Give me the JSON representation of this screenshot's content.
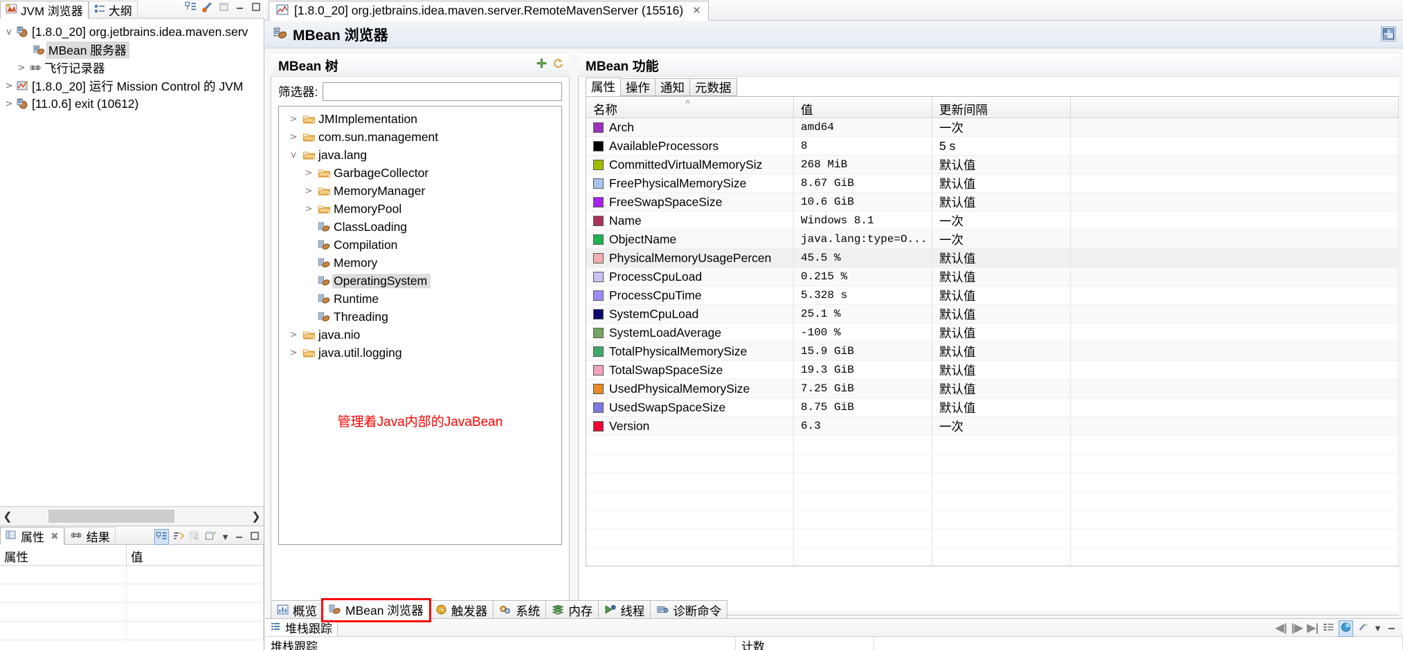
{
  "left_panel": {
    "tabs": [
      {
        "label": "JVM 浏览器",
        "icon": "jvm-browser-icon",
        "active": true
      },
      {
        "label": "大纲",
        "icon": "outline-icon",
        "active": false
      }
    ],
    "toolbar_icons": [
      "collapse-all-icon",
      "connect-icon"
    ],
    "window_buttons": [
      "new-window-icon",
      "minimize-icon",
      "maximize-icon"
    ],
    "tree": [
      {
        "label": "[1.8.0_20] org.jetbrains.idea.maven.serv",
        "indent": 0,
        "twisty": "v",
        "icon": "jvm-connection-icon",
        "selected": false
      },
      {
        "label": "MBean 服务器",
        "indent": 1,
        "twisty": "",
        "icon": "mbean-server-icon",
        "selected": true
      },
      {
        "label": "飞行记录器",
        "indent": 1,
        "twisty": ">",
        "icon": "flight-recorder-icon",
        "selected": false
      },
      {
        "label": "[1.8.0_20] 运行 Mission Control 的 JVM",
        "indent": 0,
        "twisty": ">",
        "icon": "mission-control-icon",
        "selected": false
      },
      {
        "label": "[11.0.6] exit (10612)",
        "indent": 0,
        "twisty": ">",
        "icon": "jvm-connection-icon",
        "selected": false
      }
    ],
    "bottom_tabs": [
      {
        "label": "属性",
        "icon": "properties-icon",
        "active": true,
        "closable": true
      },
      {
        "label": "结果",
        "icon": "result-icon",
        "active": false,
        "closable": false
      }
    ],
    "bottom_toolbar_icons": [
      "tree-layout-icon",
      "sort-icon",
      "copy-table-icon",
      "export-icon",
      "view-menu-icon",
      "minimize-icon",
      "maximize-icon"
    ],
    "bottom_table_headers": [
      "属性",
      "值"
    ]
  },
  "editor": {
    "tab": {
      "label": "[1.8.0_20] org.jetbrains.idea.maven.server.RemoteMavenServer (15516)",
      "icon": "jvm-chart-icon",
      "close_label": "✕"
    },
    "title": "MBean 浏览器",
    "title_icon": "mbean-browser-icon",
    "header_button": "layout-toggle-icon"
  },
  "mbean_tree_pane": {
    "title": "MBean 树",
    "toolbar_icons": [
      "add-icon",
      "refresh-icon"
    ],
    "filter_label": "筛选器:",
    "filter_value": "",
    "filter_placeholder": "",
    "nodes": [
      {
        "label": "JMImplementation",
        "indent": 0,
        "twisty": ">",
        "icon": "folder-icon",
        "selected": false
      },
      {
        "label": "com.sun.management",
        "indent": 0,
        "twisty": ">",
        "icon": "folder-icon",
        "selected": false
      },
      {
        "label": "java.lang",
        "indent": 0,
        "twisty": "v",
        "icon": "folder-icon",
        "selected": false
      },
      {
        "label": "GarbageCollector",
        "indent": 1,
        "twisty": ">",
        "icon": "folder-icon",
        "selected": false
      },
      {
        "label": "MemoryManager",
        "indent": 1,
        "twisty": ">",
        "icon": "folder-icon",
        "selected": false
      },
      {
        "label": "MemoryPool",
        "indent": 1,
        "twisty": ">",
        "icon": "folder-icon",
        "selected": false
      },
      {
        "label": "ClassLoading",
        "indent": 1,
        "twisty": "",
        "icon": "mbean-icon",
        "selected": false
      },
      {
        "label": "Compilation",
        "indent": 1,
        "twisty": "",
        "icon": "mbean-icon",
        "selected": false
      },
      {
        "label": "Memory",
        "indent": 1,
        "twisty": "",
        "icon": "mbean-icon",
        "selected": false
      },
      {
        "label": "OperatingSystem",
        "indent": 1,
        "twisty": "",
        "icon": "mbean-icon",
        "selected": true
      },
      {
        "label": "Runtime",
        "indent": 1,
        "twisty": "",
        "icon": "mbean-icon",
        "selected": false
      },
      {
        "label": "Threading",
        "indent": 1,
        "twisty": "",
        "icon": "mbean-icon",
        "selected": false
      },
      {
        "label": "java.nio",
        "indent": 0,
        "twisty": ">",
        "icon": "folder-icon",
        "selected": false
      },
      {
        "label": "java.util.logging",
        "indent": 0,
        "twisty": ">",
        "icon": "folder-icon",
        "selected": false
      }
    ],
    "annotation": "管理着Java内部的JavaBean",
    "annotation_color": "#ff0000"
  },
  "mbean_features_pane": {
    "title": "MBean 功能",
    "tabs": [
      {
        "label": "属性",
        "active": true
      },
      {
        "label": "操作",
        "active": false
      },
      {
        "label": "通知",
        "active": false
      },
      {
        "label": "元数据",
        "active": false
      }
    ],
    "columns": [
      "名称",
      "值",
      "更新间隔"
    ],
    "sort_column": 0,
    "sort_direction": "asc",
    "rows": [
      {
        "color": "#9933bb",
        "name": "Arch",
        "value": "amd64",
        "interval": "一次"
      },
      {
        "color": "#000000",
        "name": "AvailableProcessors",
        "value": "8",
        "interval": "5 s"
      },
      {
        "color": "#a3bd00",
        "name": "CommittedVirtualMemorySiz",
        "value": "268 MiB",
        "interval": "默认值"
      },
      {
        "color": "#a8c5f0",
        "name": "FreePhysicalMemorySize",
        "value": "8.67 GiB",
        "interval": "默认值"
      },
      {
        "color": "#aa22ee",
        "name": "FreeSwapSpaceSize",
        "value": "10.6 GiB",
        "interval": "默认值"
      },
      {
        "color": "#ab3359",
        "name": "Name",
        "value": "Windows 8.1",
        "interval": "一次"
      },
      {
        "color": "#1fb452",
        "name": "ObjectName",
        "value": "java.lang:type=O...",
        "interval": "一次"
      },
      {
        "color": "#f5aeae",
        "name": "PhysicalMemoryUsagePercen",
        "value": "45.5 %",
        "interval": "默认值"
      },
      {
        "color": "#c9c3f2",
        "name": "ProcessCpuLoad",
        "value": "0.215 %",
        "interval": "默认值"
      },
      {
        "color": "#9b8df0",
        "name": "ProcessCpuTime",
        "value": "5.328 s",
        "interval": "默认值"
      },
      {
        "color": "#0a0a6e",
        "name": "SystemCpuLoad",
        "value": "25.1 %",
        "interval": "默认值"
      },
      {
        "color": "#74a463",
        "name": "SystemLoadAverage",
        "value": "-100 %",
        "interval": "默认值"
      },
      {
        "color": "#3fa86a",
        "name": "TotalPhysicalMemorySize",
        "value": "15.9 GiB",
        "interval": "默认值"
      },
      {
        "color": "#f2a3c0",
        "name": "TotalSwapSpaceSize",
        "value": "19.3 GiB",
        "interval": "默认值"
      },
      {
        "color": "#ee8822",
        "name": "UsedPhysicalMemorySize",
        "value": "7.25 GiB",
        "interval": "默认值"
      },
      {
        "color": "#7d7ae0",
        "name": "UsedSwapSpaceSize",
        "value": "8.75 GiB",
        "interval": "默认值"
      },
      {
        "color": "#ee0033",
        "name": "Version",
        "value": "6.3",
        "interval": "一次"
      }
    ]
  },
  "bottom_tabs": [
    {
      "label": "概览",
      "icon": "overview-icon",
      "active": false,
      "highlighted": false
    },
    {
      "label": "MBean 浏览器",
      "icon": "mbean-browser-icon",
      "active": true,
      "highlighted": true
    },
    {
      "label": "触发器",
      "icon": "trigger-icon",
      "active": false,
      "highlighted": false
    },
    {
      "label": "系统",
      "icon": "system-icon",
      "active": false,
      "highlighted": false
    },
    {
      "label": "内存",
      "icon": "memory-icon",
      "active": false,
      "highlighted": false
    },
    {
      "label": "线程",
      "icon": "thread-icon",
      "active": false,
      "highlighted": false
    },
    {
      "label": "诊断命令",
      "icon": "diagnostic-command-icon",
      "active": false,
      "highlighted": false
    }
  ],
  "stack_trace_panel": {
    "tab_label": "堆栈跟踪",
    "tab_icon": "stack-trace-icon",
    "columns": [
      "堆栈跟踪",
      "计数"
    ],
    "toolbar_icons": [
      "prev-frame-icon",
      "next-frame-icon",
      "last-frame-icon",
      "tree-icon",
      "distribution-icon",
      "settings-icon",
      "view-menu-icon",
      "minimize-icon",
      "maximize-icon"
    ]
  }
}
